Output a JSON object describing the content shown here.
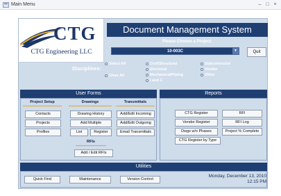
{
  "window": {
    "title": "Main Menu"
  },
  "logo": {
    "name": "CTG",
    "subtitle": "CTG Engineering LLC"
  },
  "header": {
    "title": "Document Management System"
  },
  "project": {
    "label": "Please Choose a Project:",
    "selected": "10-003C"
  },
  "quit_label": "Quit",
  "disciplines": {
    "label": "Disciplines:",
    "options": [
      "Select All",
      "Clear All",
      "Civil/Structural",
      "Electrical",
      "Mechanical/Piping",
      "I and C",
      "Subcontractor",
      "Vendor",
      "Other"
    ]
  },
  "user_forms": {
    "title": "User Forms",
    "project_setup": {
      "label": "Project Setup",
      "buttons": [
        "Contacts",
        "Projects",
        "Profiles"
      ]
    },
    "drawings": {
      "label": "Drawings",
      "buttons": [
        "Drawing History",
        "Add Multiple",
        "List",
        "Register"
      ]
    },
    "transmittals": {
      "label": "Transmittals",
      "buttons": [
        "Add/Edit Incoming",
        "Add/Edit Outgoing",
        "Email Transmittals"
      ]
    },
    "rfis": {
      "label": "RFIs",
      "buttons": [
        "Add / Edit RFIs"
      ]
    }
  },
  "reports": {
    "title": "Reports",
    "buttons": [
      "CTG Register",
      "RFI",
      "Vendor Register",
      "RFI Log",
      "Dwgs w/o Phases",
      "Project % Complete",
      "CTG Register by Type"
    ]
  },
  "utilities": {
    "title": "Utilities",
    "buttons": [
      "Quick Find",
      "Maintenance",
      "Version Control"
    ]
  },
  "datetime": {
    "date": "Monday, December 13, 2010",
    "time": "12:15 PM"
  },
  "colors": {
    "navy": "#1f3f73",
    "panel": "#cfdcea",
    "accent": "#e7a42a"
  }
}
